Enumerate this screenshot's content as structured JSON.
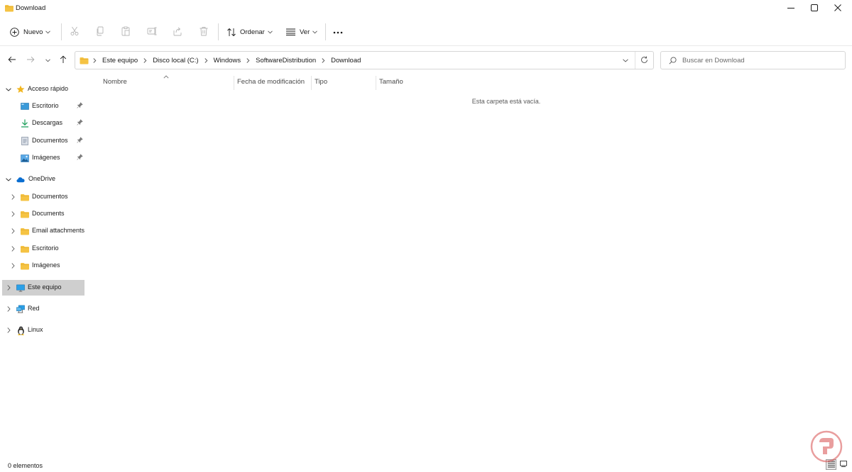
{
  "window": {
    "title": "Download",
    "icons": {
      "folder": "folder-icon",
      "minimize": "minimize-icon",
      "maximize": "maximize-icon",
      "close": "close-icon"
    }
  },
  "toolbar": {
    "new_label": "Nuevo",
    "sort_label": "Ordenar",
    "view_label": "Ver",
    "icons": [
      "cut-icon",
      "copy-icon",
      "paste-icon",
      "rename-icon",
      "share-icon",
      "delete-icon",
      "more-icon"
    ]
  },
  "address": {
    "crumbs": [
      "Este equipo",
      "Disco local (C:)",
      "Windows",
      "SoftwareDistribution",
      "Download"
    ]
  },
  "search": {
    "placeholder": "Buscar en Download"
  },
  "sidebar": {
    "quick_access": {
      "label": "Acceso rápido",
      "items": [
        {
          "label": "Escritorio",
          "icon": "desktop-icon"
        },
        {
          "label": "Descargas",
          "icon": "download-arrow-icon"
        },
        {
          "label": "Documentos",
          "icon": "document-icon"
        },
        {
          "label": "Imágenes",
          "icon": "pictures-icon"
        }
      ]
    },
    "onedrive": {
      "label": "OneDrive",
      "items": [
        {
          "label": "Documentos"
        },
        {
          "label": "Documents"
        },
        {
          "label": "Email attachments"
        },
        {
          "label": "Escritorio"
        },
        {
          "label": "Imágenes"
        }
      ]
    },
    "this_pc": {
      "label": "Este equipo"
    },
    "network": {
      "label": "Red"
    },
    "linux": {
      "label": "Linux"
    }
  },
  "columns": {
    "name": "Nombre",
    "modified": "Fecha de modificación",
    "type": "Tipo",
    "size": "Tamaño"
  },
  "content": {
    "empty_message": "Esta carpeta está vacía."
  },
  "status": {
    "item_count": "0 elementos"
  },
  "colors": {
    "folder_yellow": "#f5c343",
    "onedrive_blue": "#0a6ed1",
    "selection_gray": "#cfcfcf",
    "accent_blue": "#0063b1"
  }
}
